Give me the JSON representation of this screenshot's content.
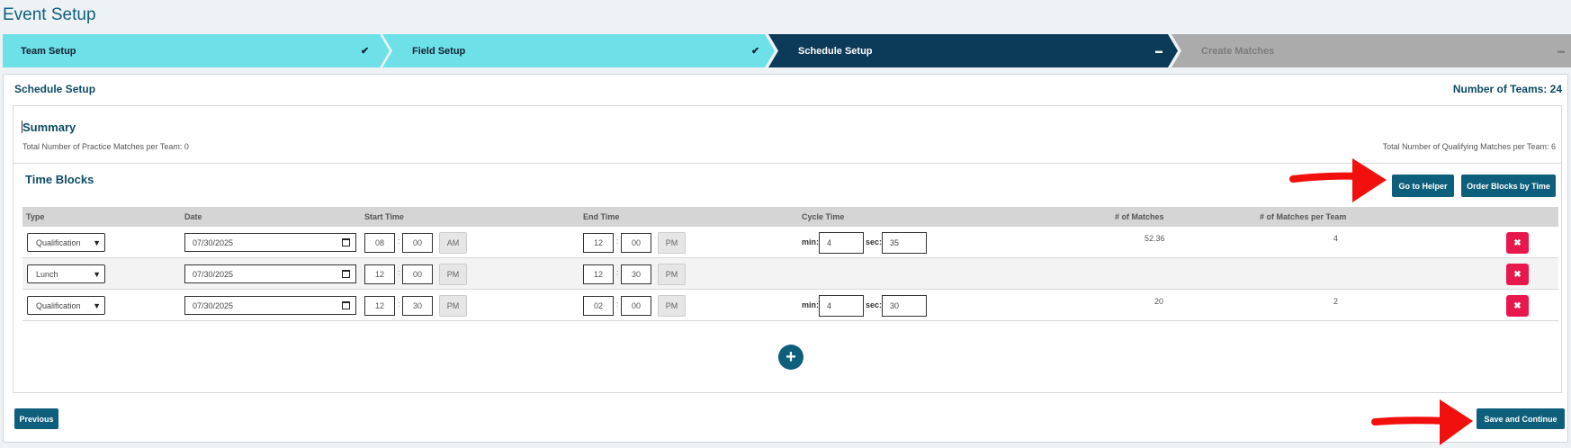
{
  "page": {
    "title": "Event Setup"
  },
  "steps": [
    {
      "label": "Team Setup",
      "status": "complete",
      "mark": "✔"
    },
    {
      "label": "Field Setup",
      "status": "complete",
      "mark": "✔"
    },
    {
      "label": "Schedule Setup",
      "status": "active",
      "mark": "▬"
    },
    {
      "label": "Create Matches",
      "status": "pending",
      "mark": "▬"
    }
  ],
  "colors": {
    "step_complete": "#6ee0e8",
    "step_active": "#0c3a59",
    "step_pending": "#ababab",
    "brand": "#0e5f7c",
    "delete": "#e8184d",
    "annotation_arrow": "#f2100e"
  },
  "card": {
    "title": "Schedule Setup",
    "teams_count": "Number of Teams: 24"
  },
  "summary": {
    "title": "Summary",
    "practice": "Total Number of Practice Matches per Team: 0",
    "qualifying": "Total Number of Qualifying Matches per Team: 6"
  },
  "time_blocks": {
    "title": "Time Blocks",
    "helper_button": "Go to Helper",
    "order_button": "Order Blocks by Time",
    "columns": [
      "Type",
      "Date",
      "Start Time",
      "End Time",
      "Cycle Time",
      "# of Matches",
      "# of Matches per Team"
    ],
    "rows": [
      {
        "type": "Qualification",
        "date": "07/30/2025",
        "start_h": "08",
        "start_m": "00",
        "start_ampm": "AM",
        "end_h": "12",
        "end_m": "00",
        "end_ampm": "PM",
        "cycle_min": "4",
        "cycle_sec": "35",
        "matches": "52.36",
        "matches_per_team": "4"
      },
      {
        "type": "Lunch",
        "date": "07/30/2025",
        "start_h": "12",
        "start_m": "00",
        "start_ampm": "PM",
        "end_h": "12",
        "end_m": "30",
        "end_ampm": "PM"
      },
      {
        "type": "Qualification",
        "date": "07/30/2025",
        "start_h": "12",
        "start_m": "30",
        "start_ampm": "PM",
        "end_h": "02",
        "end_m": "00",
        "end_ampm": "PM",
        "cycle_min": "4",
        "cycle_sec": "30",
        "matches": "20",
        "matches_per_team": "2"
      }
    ],
    "min_label": "min:",
    "sec_label": "sec:",
    "colon": ":",
    "delete_glyph": "✖",
    "add_glyph": "+"
  },
  "footer": {
    "previous": "Previous",
    "save": "Save and Continue"
  }
}
